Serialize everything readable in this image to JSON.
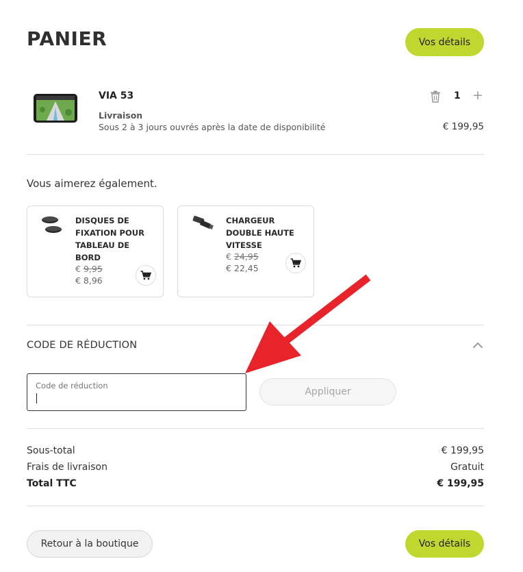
{
  "header": {
    "title": "PANIER",
    "details_button": "Vos détails"
  },
  "cart_item": {
    "name": "VIA 53",
    "delivery_label": "Livraison",
    "delivery_text": "Sous 2 à 3 jours ouvrés après la date de disponibilité",
    "quantity": "1",
    "price": "€ 199,95"
  },
  "recommendations": {
    "heading": "Vous aimerez également.",
    "items": [
      {
        "name": "DISQUES DE FIXATION POUR TABLEAU DE BORD",
        "currency": "€",
        "old_price": "9,95",
        "new_price": "€ 8,96"
      },
      {
        "name": "CHARGEUR DOUBLE HAUTE VITESSE",
        "currency": "€",
        "old_price": "24,95",
        "new_price": "€ 22,45"
      }
    ]
  },
  "discount": {
    "title": "CODE DE RÉDUCTION",
    "placeholder": "Code de réduction",
    "apply_button": "Appliquer"
  },
  "summary": {
    "subtotal_label": "Sous-total",
    "subtotal_value": "€ 199,95",
    "shipping_label": "Frais de livraison",
    "shipping_value": "Gratuit",
    "total_label": "Total TTC",
    "total_value": "€ 199,95"
  },
  "footer": {
    "back_button": "Retour à la boutique",
    "details_button": "Vos détails"
  },
  "colors": {
    "accent": "#c0d72f",
    "annotation_arrow": "#e8242a"
  },
  "icons": [
    "trash-icon",
    "plus-icon",
    "cart-icon",
    "chevron-up-icon",
    "annotation-arrow"
  ]
}
